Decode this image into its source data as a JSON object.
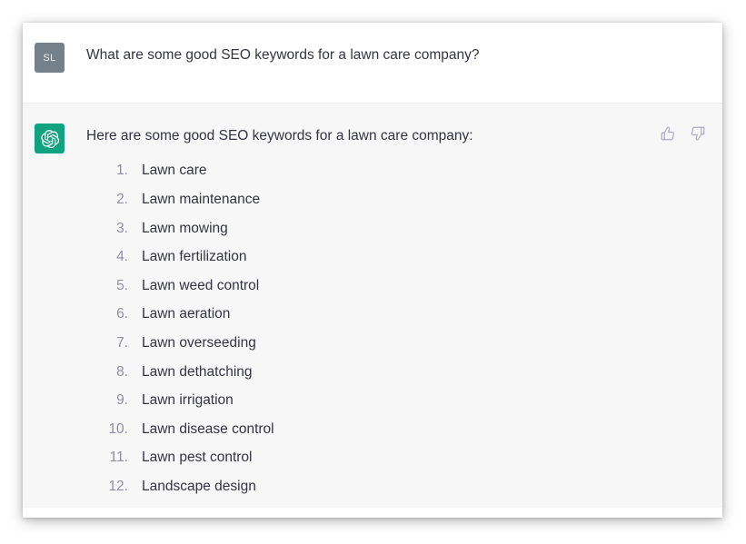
{
  "card": {
    "user_message": {
      "avatar_initials": "SL",
      "avatar_color": "#74818a",
      "text": "What are some good SEO keywords for a lawn care company?"
    },
    "assistant_message": {
      "avatar_icon": "openai-logo-icon",
      "avatar_color": "#10a37f",
      "text": "Here are some good SEO keywords for a lawn care company:",
      "feedback": {
        "thumbs_up_label": "thumbs-up",
        "thumbs_down_label": "thumbs-down"
      },
      "keywords": [
        {
          "num": "1.",
          "label": "Lawn care"
        },
        {
          "num": "2.",
          "label": "Lawn maintenance"
        },
        {
          "num": "3.",
          "label": "Lawn mowing"
        },
        {
          "num": "4.",
          "label": "Lawn fertilization"
        },
        {
          "num": "5.",
          "label": "Lawn weed control"
        },
        {
          "num": "6.",
          "label": "Lawn aeration"
        },
        {
          "num": "7.",
          "label": "Lawn overseeding"
        },
        {
          "num": "8.",
          "label": "Lawn dethatching"
        },
        {
          "num": "9.",
          "label": "Lawn irrigation"
        },
        {
          "num": "10.",
          "label": "Lawn disease control"
        },
        {
          "num": "11.",
          "label": "Lawn pest control"
        },
        {
          "num": "12.",
          "label": "Landscape design"
        }
      ]
    }
  }
}
